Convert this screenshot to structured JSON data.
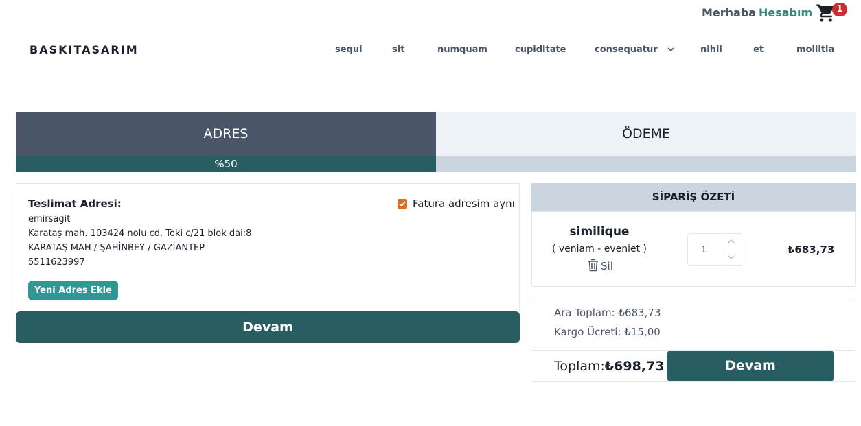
{
  "header": {
    "greeting": "Merhaba",
    "account_label": "Hesabım",
    "cart_count": "1",
    "cart_icon": "cart-icon"
  },
  "navbar": {
    "brand": "BASKITASARIM",
    "items": [
      {
        "label": "sequi"
      },
      {
        "label": "sit"
      },
      {
        "label": "numquam"
      },
      {
        "label": "cupiditate"
      },
      {
        "label": "consequatur",
        "dropdown": true
      },
      {
        "label": "nihil"
      },
      {
        "label": "et"
      },
      {
        "label": "mollitia"
      }
    ]
  },
  "steps": {
    "address_label": "ADRES",
    "payment_label": "ÖDEME",
    "progress_text": "%50",
    "progress_value": 0.5
  },
  "address": {
    "title": "Teslimat Adresi:",
    "same_invoice_label": "Fatura adresim aynı",
    "same_invoice_checked": true,
    "name": "emirsagit",
    "street": "Karataş mah. 103424 nolu cd. Toki c/21 blok dai:8",
    "district": "KARATAŞ MAH / ŞAHİNBEY / GAZİANTEP",
    "phone": "5511623997",
    "new_address_button": "Yeni Adres Ekle",
    "continue_button": "Devam"
  },
  "summary": {
    "title": "SİPARİŞ ÖZETİ",
    "product": {
      "name": "similique",
      "variant": "( veniam - eveniet )",
      "delete_label": "Sil",
      "quantity": "1",
      "price": "₺683,73"
    },
    "subtotal": "Ara Toplam: ₺683,73",
    "shipping": "Kargo Ücreti: ₺15,00",
    "total_label": "Toplam:",
    "total_value": "₺698,73",
    "continue_button": "Devam"
  },
  "colors": {
    "primary_dark": "#285e61",
    "accent_teal": "#319795",
    "step_active": "#4a5568",
    "step_inactive": "#edf2f7",
    "badge": "#c53030",
    "checkbox": "#dd6b20"
  }
}
